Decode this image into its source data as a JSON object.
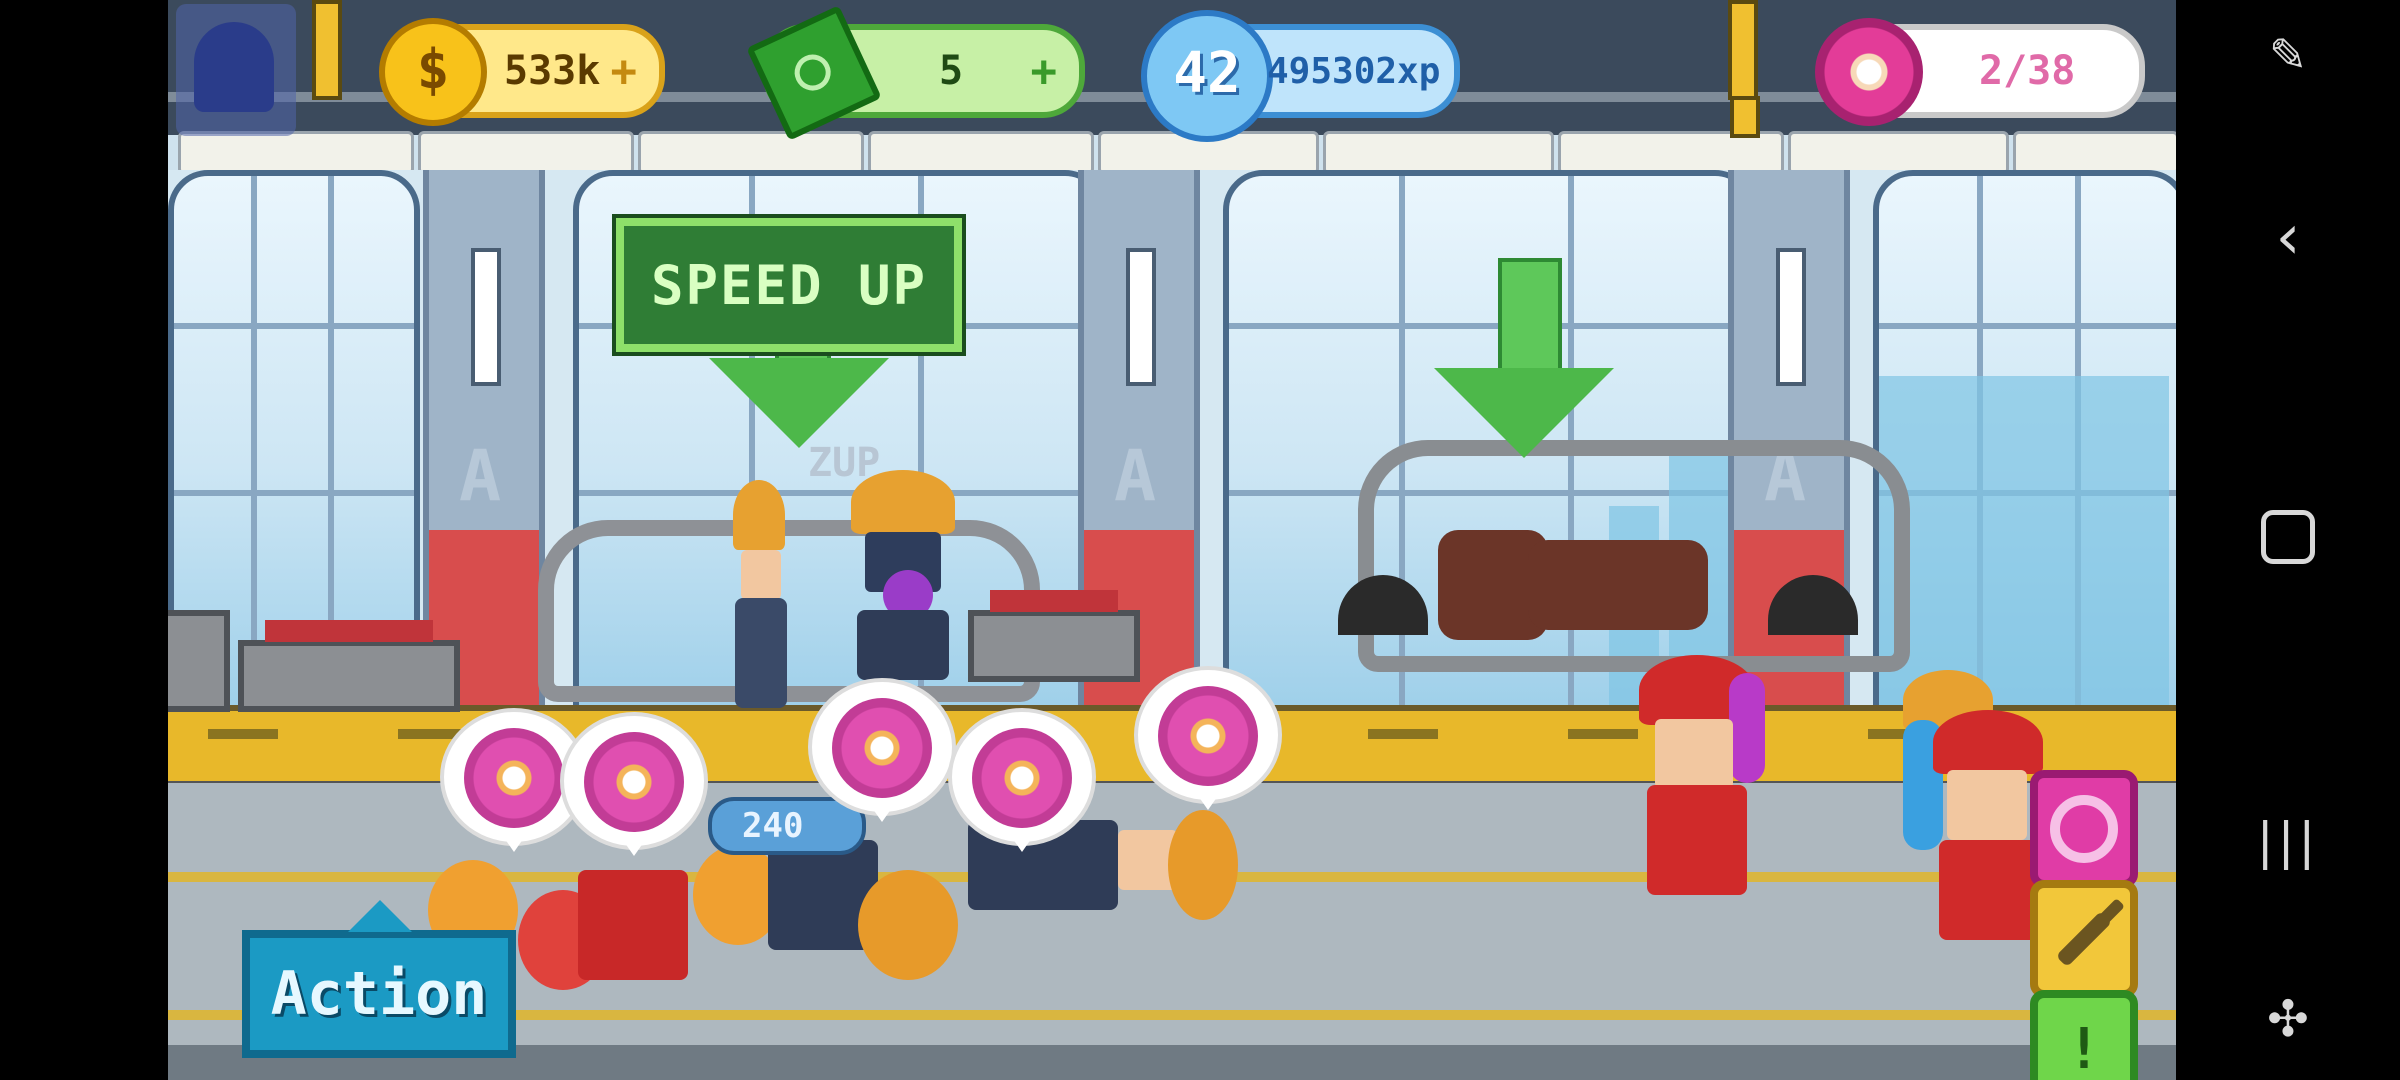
{
  "hud": {
    "coins": "533k",
    "cash": "5",
    "level": "42",
    "xp": "495302xp",
    "donuts": "2/38",
    "plus_symbol": "+"
  },
  "world": {
    "speed_up_label": "SPEED UP",
    "zup_label": "ZUP",
    "timer_label": "240",
    "pillar_mark": "A"
  },
  "buttons": {
    "action_label": "Action",
    "donut_shop_icon": "donut-ring-icon",
    "tools_icon": "wrench-icon",
    "alert_icon": "exclamation-icon",
    "alert_symbol": "!"
  },
  "navbar": {
    "icons": [
      "screen-pen-icon",
      "back-icon",
      "home-icon",
      "recents-icon",
      "game-tools-icon"
    ]
  },
  "colors": {
    "coin": "#f8c21a",
    "cash": "#2fa02f",
    "xp": "#3c8fd4",
    "donut": "#e33c98",
    "action": "#1b9ac4"
  }
}
